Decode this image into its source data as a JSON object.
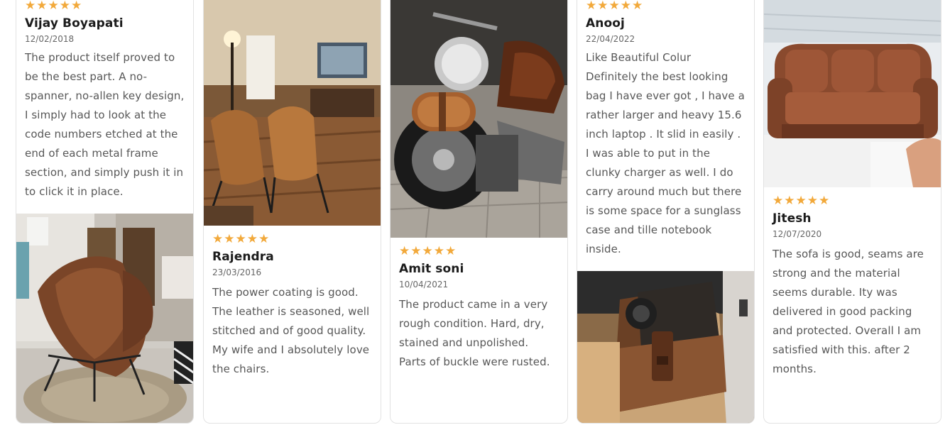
{
  "colors": {
    "star": "#f2a93b",
    "name": "#1c1c1c",
    "text": "#575757",
    "border": "#e2e2e2"
  },
  "star_icon": "★",
  "reviews": [
    {
      "rating": 5,
      "name": "Vijay Boyapati",
      "date": "12/02/2018",
      "text": "The product itself proved to be the best part. A no-spanner, no-allen key design, I simply had to look at the code numbers etched at the end of each metal frame section, and simply push it in to click it in place.",
      "photo": "leather butterfly chair in living room"
    },
    {
      "rating": 5,
      "name": "Rajendra",
      "date": "23/03/2016",
      "text": "The power coating is good. The leather is seasoned, well stitched and of good quality. My wife and I absolutely love the chairs.",
      "photo": "two leather butterfly chairs in dining room"
    },
    {
      "rating": 5,
      "name": "Amit soni",
      "date": "10/04/2021",
      "text": "The product came in a very rough condition. Hard, dry, stained and unpolished. Parts of buckle were rusted.",
      "photo": "leather tool roll on motorcycle"
    },
    {
      "rating": 5,
      "name": "Anooj",
      "date": "22/04/2022",
      "text": "Like Beautiful Colur Definitely the best looking bag I have ever got , I have a rather larger and heavy 15.6 inch laptop . It slid in easily . I was able to put in the clunky charger as well. I do carry around much but there is some space for a sunglass case and tille notebook inside.",
      "photo": "brown leather messenger bag"
    },
    {
      "rating": 5,
      "name": "Jitesh",
      "date": "12/07/2020",
      "text": "The sofa is good, seams are strong and the material seems durable. Ity was delivered in good packing and protected. Overall I am satisfied with this. after 2 months.",
      "photo": "brown leather three-seat sofa"
    }
  ]
}
